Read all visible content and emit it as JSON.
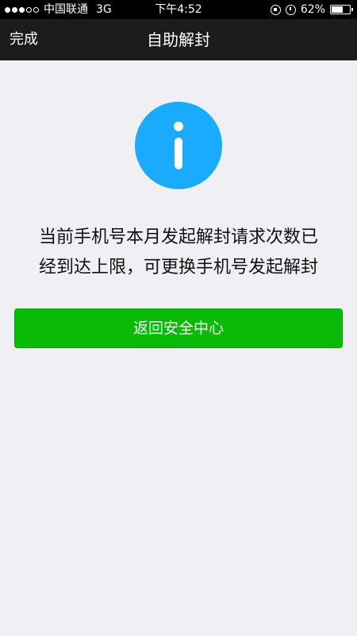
{
  "status_bar": {
    "signal": "●●●○○",
    "carrier": "中国联通",
    "network": "3G",
    "time": "下午4:52",
    "battery": "62%",
    "battery_level": 0.62
  },
  "nav": {
    "done_label": "完成",
    "title": "自助解封"
  },
  "content": {
    "icon": "info-icon",
    "message_line1": "当前手机号本月发起解封请求次数已",
    "message_line2": "经到达上限，可更换手机号发起解封",
    "button_label": "返回安全中心"
  },
  "colors": {
    "accent_blue": "#1aabff",
    "button_green": "#09bb07",
    "background": "#efeff4",
    "nav_background": "#1c1c1e"
  }
}
